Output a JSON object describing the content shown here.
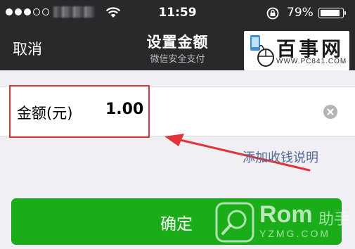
{
  "status_bar": {
    "time": "11:59",
    "battery_percent": "79%",
    "battery_level": 0.79
  },
  "nav": {
    "back_label": "取消",
    "title": "设置金额",
    "subtitle": "微信安全支付"
  },
  "amount": {
    "label": "金额(元)",
    "value": "1.00"
  },
  "add_note_label": "添加收钱说明",
  "confirm_label": "确定",
  "watermarks": {
    "top_text": "百事网",
    "top_url": "WWW.PC841.COM",
    "bottom_rom": "Rom",
    "bottom_zhushou": "助手",
    "bottom_url": "YZMG.COM"
  },
  "colors": {
    "nav_bg": "#29292c",
    "confirm_green": "#1aad19",
    "link_blue": "#576b95",
    "annotation_red": "#e0333a"
  }
}
